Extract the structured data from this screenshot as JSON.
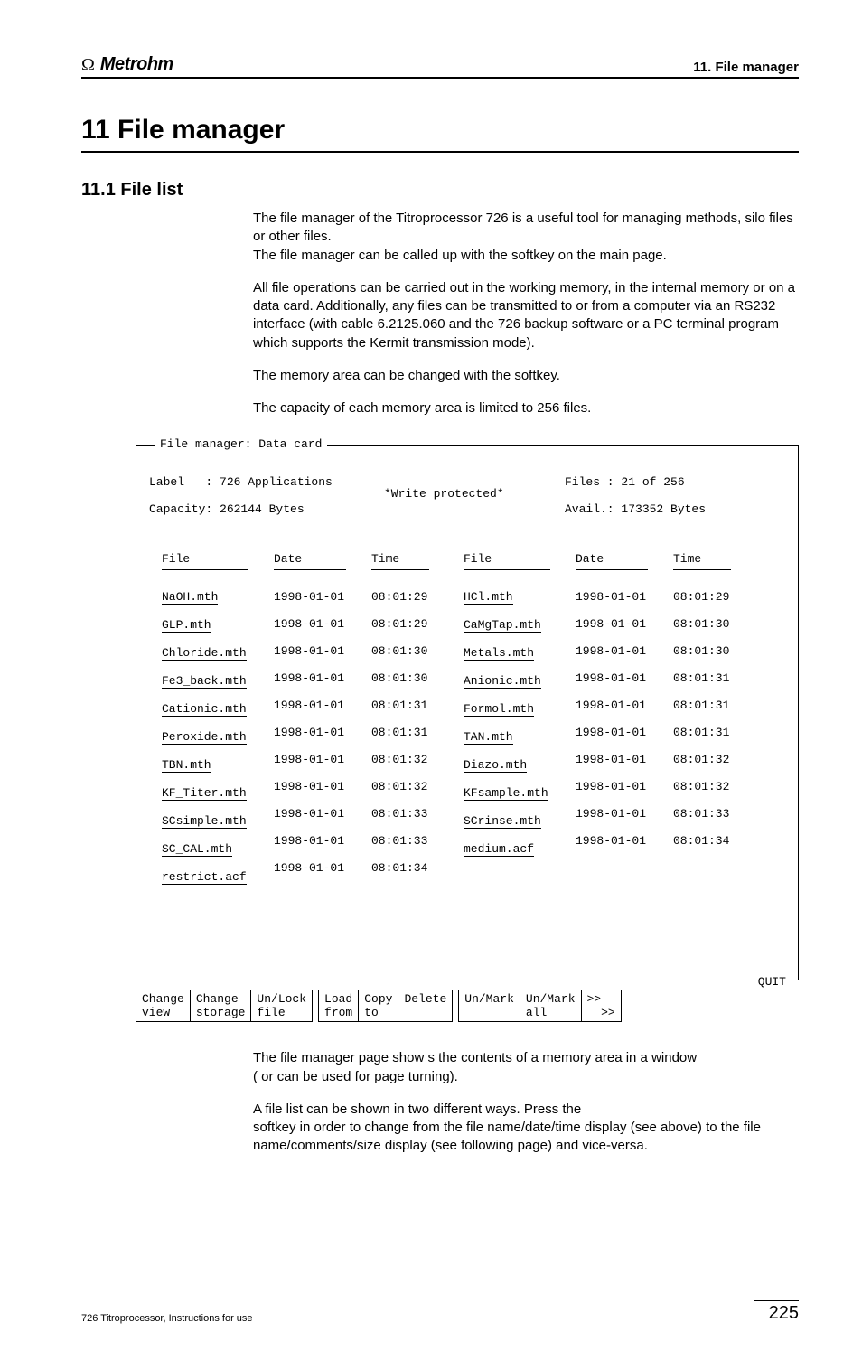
{
  "brand": {
    "symbol": "Ω",
    "name": "Metrohm"
  },
  "breadcrumb": "11. File manager",
  "h1": "11 File manager",
  "h2": "11.1 File list",
  "paragraphs": {
    "p1a": "The file manager of the Titroprocessor 726 is a useful tool for managing methods, silo files or other files.",
    "p1b_pre": "The file manager can be called up with the ",
    "p1b_post": " softkey on the main page.",
    "p2": "All file operations can be carried out in the working memory, in the internal memory or on a data card. Additionally, any files can be transmitted to or from a computer via an RS232 interface (with cable 6.2125.060 and the 726 backup software or a PC terminal program which supports the Kermit transmission mode).",
    "p3_pre": "The memory area can be changed with the ",
    "p3_post": " softkey.",
    "p4": "The capacity of each memory area is limited to 256 files.",
    "p5a": "The file manager page show s the contents of a memory area in a window ",
    "p5b_open": "(",
    "p5b_or": " or ",
    "p5b_close": " can be used for page turning).",
    "p6a": "A file list can be shown in two different ways. Press the ",
    "p6b": " softkey in order to change from the file name/date/time display (see above) to the file name/comments/size display (see following page) and vice-versa."
  },
  "terminal": {
    "title": "File manager: Data card",
    "header": {
      "label_line": "Label   : 726 Applications",
      "cap_line": "Capacity: 262144 Bytes",
      "wp": "*Write protected*",
      "files_line": "Files : 21 of 256",
      "avail_line": "Avail.: 173352 Bytes"
    },
    "col_heads": {
      "file": "File",
      "date": "Date",
      "time": "Time"
    },
    "left": [
      [
        "NaOH.mth",
        "1998-01-01",
        "08:01:29"
      ],
      [
        "GLP.mth",
        "1998-01-01",
        "08:01:29"
      ],
      [
        "Chloride.mth",
        "1998-01-01",
        "08:01:30"
      ],
      [
        "Fe3_back.mth",
        "1998-01-01",
        "08:01:30"
      ],
      [
        "Cationic.mth",
        "1998-01-01",
        "08:01:31"
      ],
      [
        "Peroxide.mth",
        "1998-01-01",
        "08:01:31"
      ],
      [
        "TBN.mth",
        "1998-01-01",
        "08:01:32"
      ],
      [
        "KF_Titer.mth",
        "1998-01-01",
        "08:01:32"
      ],
      [
        "SCsimple.mth",
        "1998-01-01",
        "08:01:33"
      ],
      [
        "SC_CAL.mth",
        "1998-01-01",
        "08:01:33"
      ],
      [
        "restrict.acf",
        "1998-01-01",
        "08:01:34"
      ]
    ],
    "right": [
      [
        "HCl.mth",
        "1998-01-01",
        "08:01:29"
      ],
      [
        "CaMgTap.mth",
        "1998-01-01",
        "08:01:30"
      ],
      [
        "Metals.mth",
        "1998-01-01",
        "08:01:30"
      ],
      [
        "Anionic.mth",
        "1998-01-01",
        "08:01:31"
      ],
      [
        "Formol.mth",
        "1998-01-01",
        "08:01:31"
      ],
      [
        "TAN.mth",
        "1998-01-01",
        "08:01:31"
      ],
      [
        "Diazo.mth",
        "1998-01-01",
        "08:01:32"
      ],
      [
        "KFsample.mth",
        "1998-01-01",
        "08:01:32"
      ],
      [
        "SCrinse.mth",
        "1998-01-01",
        "08:01:33"
      ],
      [
        "medium.acf",
        "1998-01-01",
        "08:01:34"
      ]
    ],
    "quit": "QUIT",
    "softkeys": {
      "g1": [
        "Change\nview",
        "Change\nstorage",
        "Un/Lock\nfile"
      ],
      "g2": [
        "Load\nfrom",
        "Copy\nto",
        "Delete\n"
      ],
      "g3": [
        "Un/Mark\n",
        "Un/Mark\nall",
        ">>\n  >>"
      ]
    }
  },
  "footer": {
    "left": "726 Titroprocessor, Instructions for use",
    "page": "225"
  }
}
